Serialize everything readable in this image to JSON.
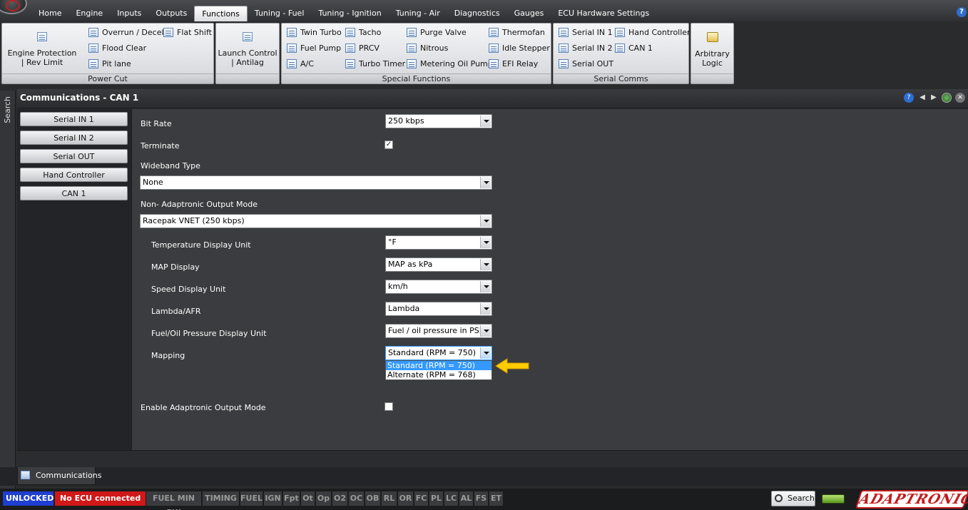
{
  "menu": {
    "tabs": [
      "Home",
      "Engine",
      "Inputs",
      "Outputs",
      "Functions",
      "Tuning - Fuel",
      "Tuning - Ignition",
      "Tuning - Air",
      "Diagnostics",
      "Gauges",
      "ECU Hardware Settings"
    ],
    "active": "Functions"
  },
  "ribbon": {
    "power_cut": {
      "label": "Power Cut",
      "engine_protection": "Engine Protection | Rev Limit",
      "overrun": "Overrun / Decel",
      "flood_clear": "Flood Clear",
      "pit_lane": "Pit lane",
      "flat_shift": "Flat Shift"
    },
    "launch_control": "Launch Control | Antilag",
    "special_functions": {
      "label": "Special Functions",
      "twin_turbo": "Twin Turbo",
      "fuel_pump": "Fuel Pump",
      "ac": "A/C",
      "tacho": "Tacho",
      "prcv": "PRCV",
      "turbo_timer": "Turbo Timer",
      "purge_valve": "Purge Valve",
      "nitrous": "Nitrous",
      "metering_oil_pump": "Metering Oil Pump",
      "thermofan": "Thermofan",
      "idle_stepper": "Idle Stepper",
      "efi_relay": "EFI Relay"
    },
    "serial_comms": {
      "label": "Serial Comms",
      "serial_in_1": "Serial IN 1",
      "serial_in_2": "Serial IN 2",
      "serial_out": "Serial OUT",
      "hand_controller": "Hand Controller",
      "can_1": "CAN 1"
    },
    "arbitrary_logic": "Arbitrary Logic"
  },
  "sidebar": {
    "search_label": "Search"
  },
  "panel": {
    "title": "Communications - CAN 1",
    "nav": [
      "Serial IN 1",
      "Serial IN 2",
      "Serial OUT",
      "Hand Controller",
      "CAN 1"
    ],
    "fields": {
      "bit_rate": {
        "label": "Bit Rate",
        "value": "250 kbps"
      },
      "terminate": {
        "label": "Terminate",
        "checked": true
      },
      "wideband_type": {
        "label": "Wideband Type",
        "value": "None"
      },
      "output_mode": {
        "label": "Non- Adaptronic Output Mode",
        "value": "Racepak VNET (250 kbps)"
      },
      "temp_unit": {
        "label": "Temperature Display Unit",
        "value": "°F"
      },
      "map_display": {
        "label": "MAP Display",
        "value": "MAP as kPa"
      },
      "speed_unit": {
        "label": "Speed Display Unit",
        "value": "km/h"
      },
      "lambda_afr": {
        "label": "Lambda/AFR",
        "value": "Lambda"
      },
      "pressure_unit": {
        "label": "Fuel/Oil Pressure Display Unit",
        "value": "Fuel / oil pressure in PSI"
      },
      "mapping": {
        "label": "Mapping",
        "value": "Standard (RPM = 750)",
        "options": [
          "Standard (RPM = 750)",
          "Alternate (RPM = 768)"
        ],
        "highlighted": "Standard (RPM = 750)"
      },
      "enable_output": {
        "label": "Enable Adaptronic Output Mode",
        "checked": false
      }
    }
  },
  "bottom_tab": {
    "label": "Communications"
  },
  "status": {
    "unlocked": "UNLOCKED",
    "ecu": "No ECU connected",
    "indicators": [
      "FUEL MIN PW",
      "TIMING",
      "FUEL",
      "IGN",
      "Fpt",
      "Ot",
      "Op",
      "O2",
      "OC",
      "OB",
      "RL",
      "OR",
      "FC",
      "PL",
      "LC",
      "AL",
      "FS",
      "ET"
    ],
    "search": "Search",
    "brand": "ADAPTRONIC"
  },
  "colors": {
    "unlocked_bg": "#1f3fd0",
    "ecu_bg": "#d01818",
    "highlight": "#3399ff",
    "arrow": "#ffcc00"
  }
}
